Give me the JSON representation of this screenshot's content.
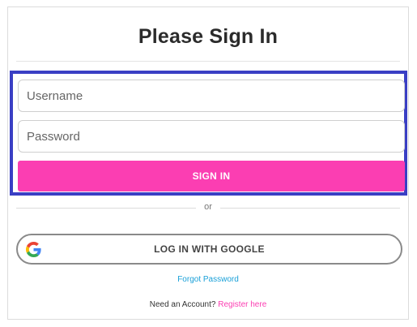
{
  "title": "Please Sign In",
  "form": {
    "username_placeholder": "Username",
    "password_placeholder": "Password",
    "signin_label": "SIGN IN"
  },
  "divider_text": "or",
  "google_label": "LOG IN WITH GOOGLE",
  "forgot_label": "Forgot Password",
  "register": {
    "prompt": "Need an Account?",
    "link_label": "Register here"
  },
  "colors": {
    "accent": "#fb3eb2",
    "focus_border": "#3a3fc4",
    "link_blue": "#1aa0d8"
  }
}
